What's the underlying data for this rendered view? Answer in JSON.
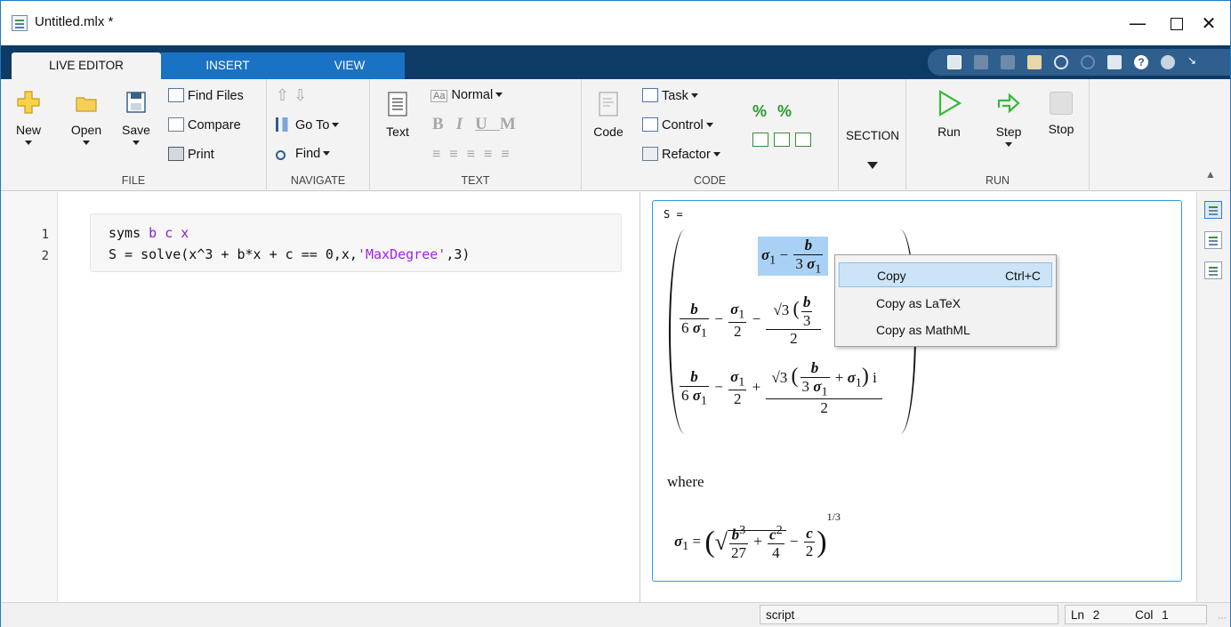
{
  "window": {
    "title": "Untitled.mlx *"
  },
  "tabs": [
    "LIVE EDITOR",
    "INSERT",
    "VIEW"
  ],
  "ribbon": {
    "file": {
      "label": "FILE",
      "new": "New",
      "open": "Open",
      "save": "Save",
      "find_files": "Find Files",
      "compare": "Compare",
      "print": "Print"
    },
    "navigate": {
      "label": "NAVIGATE",
      "go_to": "Go To",
      "find": "Find"
    },
    "text": {
      "label": "TEXT",
      "text_btn": "Text",
      "style": "Normal",
      "bold": "B",
      "italic": "I",
      "underline": "U",
      "mono": "M"
    },
    "code": {
      "label": "CODE",
      "code_btn": "Code",
      "task": "Task",
      "control": "Control",
      "refactor": "Refactor"
    },
    "section": {
      "label": "SECTION"
    },
    "run": {
      "label": "RUN",
      "run": "Run",
      "step": "Step",
      "stop": "Stop"
    }
  },
  "editor": {
    "line_numbers": [
      "1",
      "2"
    ],
    "line1_kw": "syms",
    "line1_vars": " b c x",
    "line2_code": "S = solve(x^3 + b*x + c == 0,x,",
    "line2_str": "'MaxDegree'",
    "line2_end": ",3)"
  },
  "output": {
    "var_label": "S =",
    "where": "where",
    "sigma": "σ",
    "sub1": "1",
    "sqrt3": "√3",
    "exponent": "1/3",
    "imag": "i"
  },
  "context_menu": {
    "items": [
      {
        "label": "Copy",
        "shortcut": "Ctrl+C"
      },
      {
        "label": "Copy as LaTeX",
        "shortcut": ""
      },
      {
        "label": "Copy as MathML",
        "shortcut": ""
      }
    ]
  },
  "statusbar": {
    "mode": "script",
    "ln_label": "Ln",
    "ln": "2",
    "col_label": "Col",
    "col": "1"
  },
  "colors": {
    "tab_dark": "#0e3a66",
    "tab_blue": "#1a72c4",
    "output_border": "#2e9be0",
    "run_green": "#3cb83c",
    "keyword": "#8c1fc9"
  }
}
